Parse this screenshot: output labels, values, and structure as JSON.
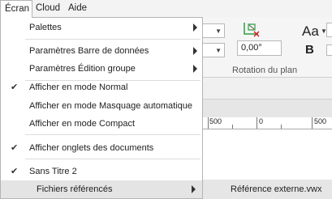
{
  "menubar": {
    "items": [
      {
        "label": "Écran",
        "open": true
      },
      {
        "label": "Cloud",
        "open": false
      },
      {
        "label": "Aide",
        "open": false
      }
    ]
  },
  "ribbon": {
    "rotation_value": "0,00°",
    "rotation_label": "Rotation du plan",
    "font_icon_text": "Aa",
    "bold_text": "B"
  },
  "ruler": {
    "labels": [
      "500",
      "0",
      "500"
    ]
  },
  "menu": {
    "items": [
      {
        "label": "Palettes",
        "checked": false,
        "submenu": true
      },
      {
        "label": "Paramètres Barre de données",
        "checked": false,
        "submenu": true
      },
      {
        "label": "Paramètres Édition groupe",
        "checked": false,
        "submenu": true
      },
      {
        "label": "Afficher en mode Normal",
        "checked": true,
        "submenu": false
      },
      {
        "label": "Afficher en mode Masquage automatique",
        "checked": false,
        "submenu": false
      },
      {
        "label": "Afficher en mode Compact",
        "checked": false,
        "submenu": false
      },
      {
        "label": "Afficher onglets des documents",
        "checked": true,
        "submenu": false
      },
      {
        "label": "Sans Titre 2",
        "checked": true,
        "submenu": false
      },
      {
        "label": "Fichiers référencés",
        "checked": false,
        "submenu": true,
        "highlighted": true
      }
    ],
    "check_glyph": "✔"
  },
  "submenu": {
    "items": [
      {
        "label": "Référence externe.vwx"
      }
    ]
  }
}
